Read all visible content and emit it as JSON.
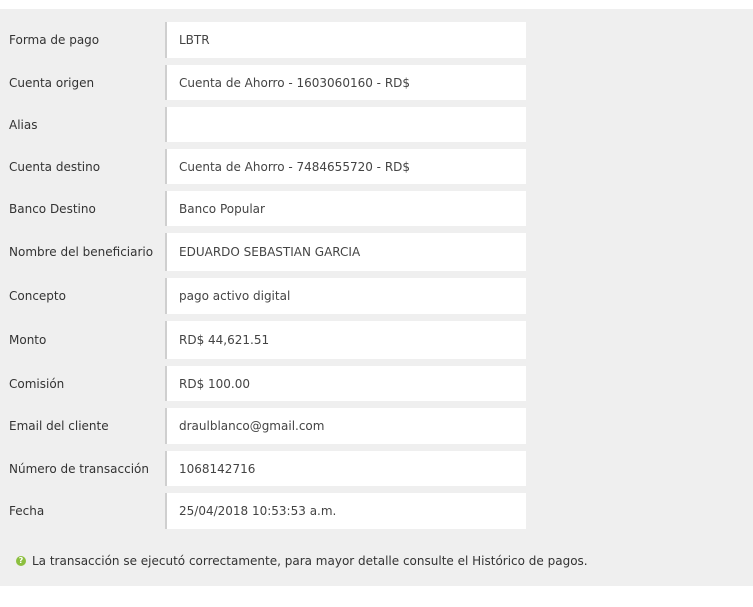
{
  "fields": [
    {
      "label": "Forma de pago",
      "value": "LBTR"
    },
    {
      "label": "Cuenta origen",
      "value": "Cuenta de Ahorro - 1603060160 - RD$"
    },
    {
      "label": "Alias",
      "value": ""
    },
    {
      "label": "Cuenta destino",
      "value": "Cuenta de Ahorro - 7484655720 - RD$"
    },
    {
      "label": "Banco Destino",
      "value": "Banco Popular"
    },
    {
      "label": "Nombre del beneficiario",
      "value": "EDUARDO SEBASTIAN GARCIA"
    },
    {
      "label": "Concepto",
      "value": "pago activo digital"
    },
    {
      "label": "Monto",
      "value": "RD$ 44,621.51"
    },
    {
      "label": "Comisión",
      "value": "RD$ 100.00"
    },
    {
      "label": "Email del cliente",
      "value": "draulblanco@gmail.com"
    },
    {
      "label": "Número de transacción",
      "value": "1068142716"
    },
    {
      "label": "Fecha",
      "value": "25/04/2018 10:53:53 a.m."
    }
  ],
  "footer": {
    "icon": "help-icon",
    "icon_glyph": "?",
    "message": "La transacción se ejecutó correctamente, para mayor detalle consulte el Histórico de pagos."
  },
  "colors": {
    "panel_background": "#efefef",
    "field_background": "#ffffff",
    "icon_green": "#8cbf3f"
  }
}
